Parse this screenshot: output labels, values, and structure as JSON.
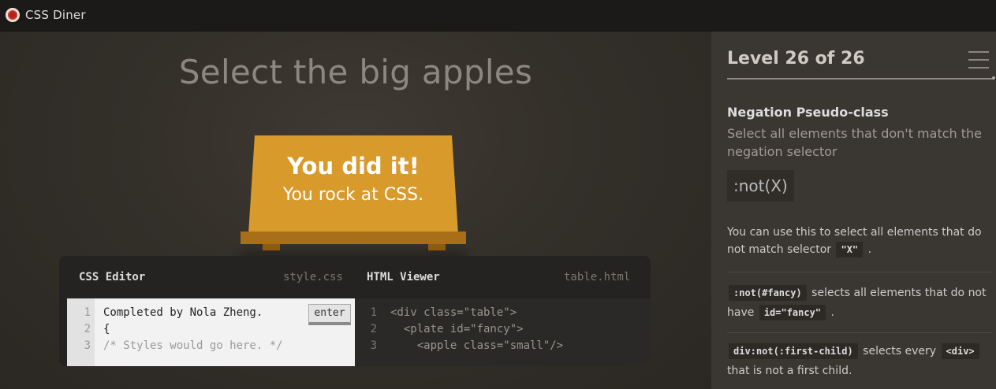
{
  "app": {
    "title": "CSS Diner"
  },
  "instruction": "Select the big apples",
  "table": {
    "line1": "You did it!",
    "line2": "You rock at CSS."
  },
  "editor": {
    "css_label": "CSS Editor",
    "css_file": "style.css",
    "html_label": "HTML Viewer",
    "html_file": "table.html",
    "enter_label": "enter",
    "css_lines": [
      {
        "num": "1",
        "text": "Completed by Nola Zheng."
      },
      {
        "num": "2",
        "text": "{"
      },
      {
        "num": "3",
        "text": "/* Styles would go here. */"
      }
    ],
    "html_lines": [
      {
        "num": "1",
        "text": "<div class=\"table\">"
      },
      {
        "num": "2",
        "text": "  <plate id=\"fancy\">"
      },
      {
        "num": "3",
        "text": "    <apple class=\"small\"/>"
      }
    ]
  },
  "sidebar": {
    "level": "Level 26 of 26",
    "progress": 1.0,
    "selector_name": "Negation Pseudo-class",
    "selector_desc": "Select all elements that don't match the negation selector",
    "syntax": ":not(X)",
    "desc_part1": "You can use this to select all elements that do not match selector",
    "desc_code": "\"X\"",
    "desc_end": ".",
    "ex1_code": ":not(#fancy)",
    "ex1_text": "selects all elements that do not have",
    "ex1_code2": "id=\"fancy\"",
    "ex1_end": ".",
    "ex2_code": "div:not(:first-child)",
    "ex2_text": "selects every",
    "ex2_code2": "<div>",
    "ex2_end": "that is not a first child."
  },
  "colors": {
    "table": "#d99a2c",
    "accent": "#c6392f"
  }
}
